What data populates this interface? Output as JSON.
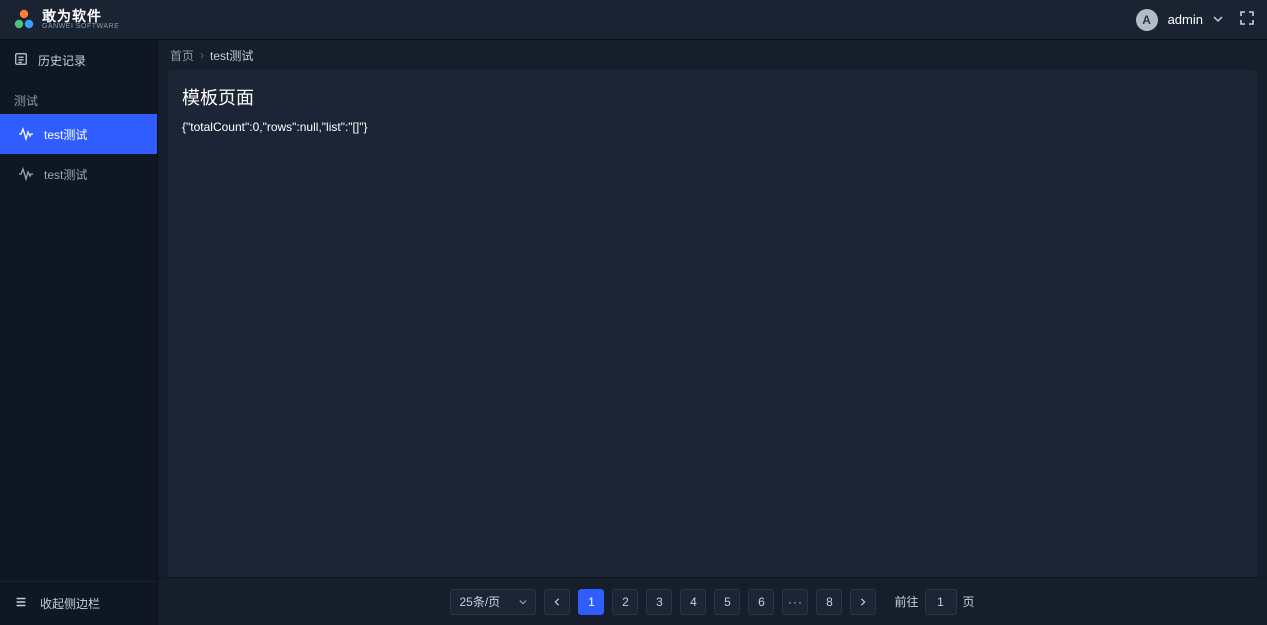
{
  "header": {
    "logo_cn": "敢为软件",
    "logo_en": "GANWEI SOFTWARE",
    "avatar_initial": "A",
    "username": "admin"
  },
  "sidebar": {
    "history_label": "历史记录",
    "group_label": "测试",
    "items": [
      {
        "label": "test测试",
        "active": true
      },
      {
        "label": "test测试",
        "active": false
      }
    ],
    "collapse_label": "收起侧边栏"
  },
  "breadcrumb": {
    "home": "首页",
    "current": "test测试"
  },
  "page": {
    "title": "模板页面",
    "json": "{\"totalCount\":0,\"rows\":null,\"list\":\"[]\"}"
  },
  "paginator": {
    "size_label": "25条/页",
    "pages": [
      "1",
      "2",
      "3",
      "4",
      "5",
      "6"
    ],
    "last_page": "8",
    "goto_label": "前往",
    "goto_value": "1",
    "goto_suffix": "页"
  }
}
